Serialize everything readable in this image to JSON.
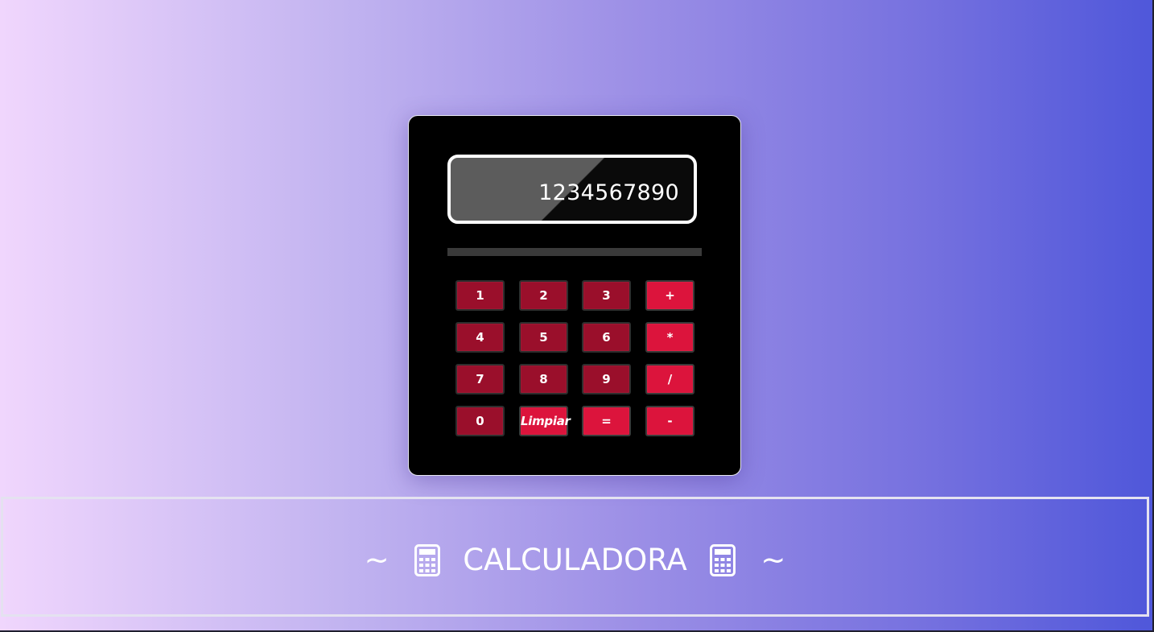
{
  "display": {
    "value": "1234567890"
  },
  "keypad": {
    "rows": [
      [
        {
          "label": "1",
          "name": "key-1",
          "kind": "num"
        },
        {
          "label": "2",
          "name": "key-2",
          "kind": "num"
        },
        {
          "label": "3",
          "name": "key-3",
          "kind": "num"
        },
        {
          "label": "+",
          "name": "key-add",
          "kind": "op"
        }
      ],
      [
        {
          "label": "4",
          "name": "key-4",
          "kind": "num"
        },
        {
          "label": "5",
          "name": "key-5",
          "kind": "num"
        },
        {
          "label": "6",
          "name": "key-6",
          "kind": "num"
        },
        {
          "label": "*",
          "name": "key-multiply",
          "kind": "op"
        }
      ],
      [
        {
          "label": "7",
          "name": "key-7",
          "kind": "num"
        },
        {
          "label": "8",
          "name": "key-8",
          "kind": "num"
        },
        {
          "label": "9",
          "name": "key-9",
          "kind": "num"
        },
        {
          "label": "/",
          "name": "key-divide",
          "kind": "op"
        }
      ],
      [
        {
          "label": "0",
          "name": "key-0",
          "kind": "num"
        },
        {
          "label": "Limpiar",
          "name": "key-clear",
          "kind": "clear"
        },
        {
          "label": "=",
          "name": "key-equals",
          "kind": "op"
        },
        {
          "label": "-",
          "name": "key-subtract",
          "kind": "op"
        }
      ]
    ]
  },
  "footer": {
    "tilde_left": "~",
    "title": "CALCULADORA",
    "tilde_right": "~",
    "icon": "calculator-icon"
  },
  "colors": {
    "number_key": "#9a0f2b",
    "operator_key": "#dc143c",
    "calculator_body": "#000000",
    "display_border": "#ffffff"
  }
}
